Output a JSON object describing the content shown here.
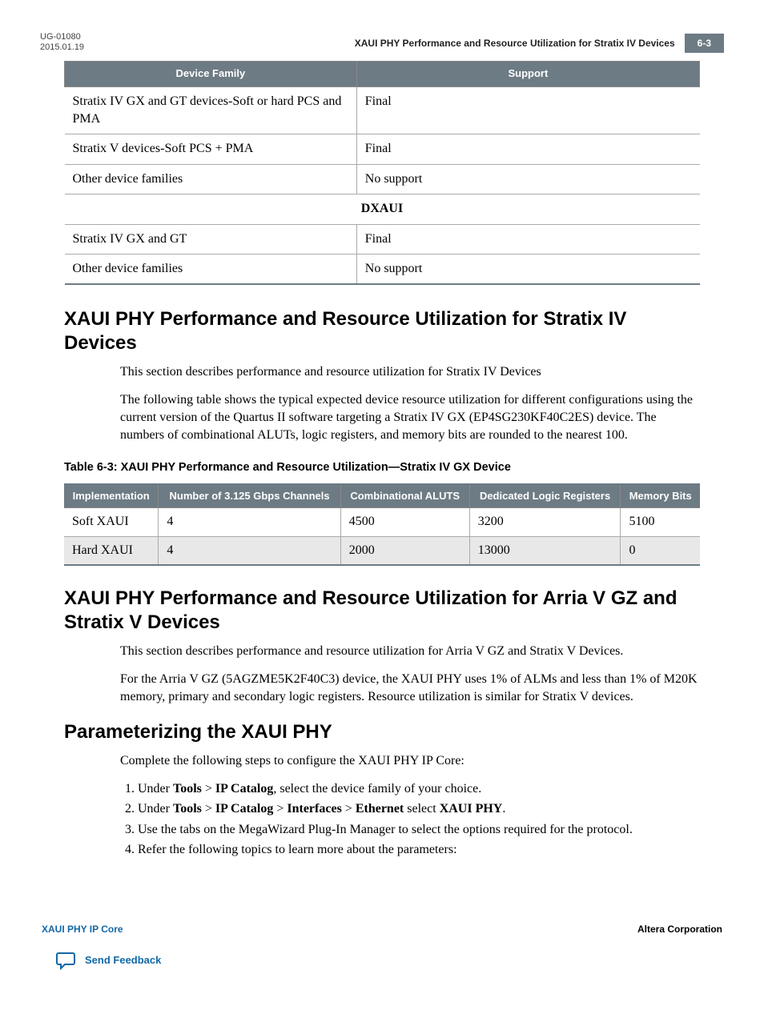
{
  "header": {
    "doc_id": "UG-01080",
    "date": "2015.01.19",
    "title": "XAUI PHY Performance and Resource Utilization for Stratix IV Devices",
    "page": "6-3"
  },
  "table1": {
    "headers": [
      "Device Family",
      "Support"
    ],
    "rows": [
      [
        "Stratix IV GX and GT devices-Soft or hard PCS and PMA",
        "Final"
      ],
      [
        "Stratix V devices-Soft PCS + PMA",
        "Final"
      ],
      [
        "Other device families",
        "No support"
      ]
    ],
    "dxaui_label": "DXAUI",
    "dxaui_rows": [
      [
        "Stratix IV GX and GT",
        "Final"
      ],
      [
        "Other device families",
        "No support"
      ]
    ]
  },
  "section1": {
    "heading": "XAUI PHY Performance and Resource Utilization for Stratix IV Devices",
    "p1": "This section describes performance and resource utilization for Stratix IV Devices",
    "p2": "The following table shows the typical expected device resource utilization for different configurations using the current version of the Quartus II software targeting a Stratix IV GX (EP4SG230KF40C2ES) device. The numbers of combinational ALUTs, logic registers, and memory bits are rounded to the nearest 100.",
    "caption": "Table 6-3: XAUI PHY Performance and Resource Utilization—Stratix IV GX Device"
  },
  "table2": {
    "headers": [
      "Implementation",
      "Number of 3.125 Gbps Channels",
      "Combinational ALUTS",
      "Dedicated Logic Registers",
      "Memory Bits"
    ],
    "rows": [
      [
        "Soft XAUI",
        "4",
        "4500",
        "3200",
        "5100"
      ],
      [
        "Hard XAUI",
        "4",
        "2000",
        "13000",
        "0"
      ]
    ]
  },
  "section2": {
    "heading": "XAUI PHY Performance and Resource Utilization for Arria V GZ and Stratix V Devices",
    "p1": "This section describes performance and resource utilization for Arria V GZ and Stratix V Devices.",
    "p2": "For the Arria V GZ (5AGZME5K2F40C3) device, the XAUI PHY uses 1% of ALMs and less than 1% of M20K memory, primary and secondary logic registers. Resource utilization is similar for Stratix V devices."
  },
  "section3": {
    "heading": "Parameterizing the XAUI PHY",
    "intro": "Complete the following steps to configure the XAUI PHY IP Core:",
    "steps_plain": [
      "Under Tools > IP Catalog, select the device family of your choice.",
      "Under Tools > IP Catalog > Interfaces > Ethernet select XAUI PHY.",
      "Use the tabs on the MegaWizard Plug-In Manager to select the options required for the protocol.",
      "Refer the following topics to learn more about the parameters:"
    ],
    "bold": {
      "tools": "Tools",
      "ipcat": "IP Catalog",
      "interfaces": "Interfaces",
      "ethernet": "Ethernet",
      "xaui": "XAUI PHY"
    }
  },
  "footer": {
    "left": "XAUI PHY IP Core",
    "right": "Altera Corporation",
    "feedback": "Send Feedback"
  }
}
